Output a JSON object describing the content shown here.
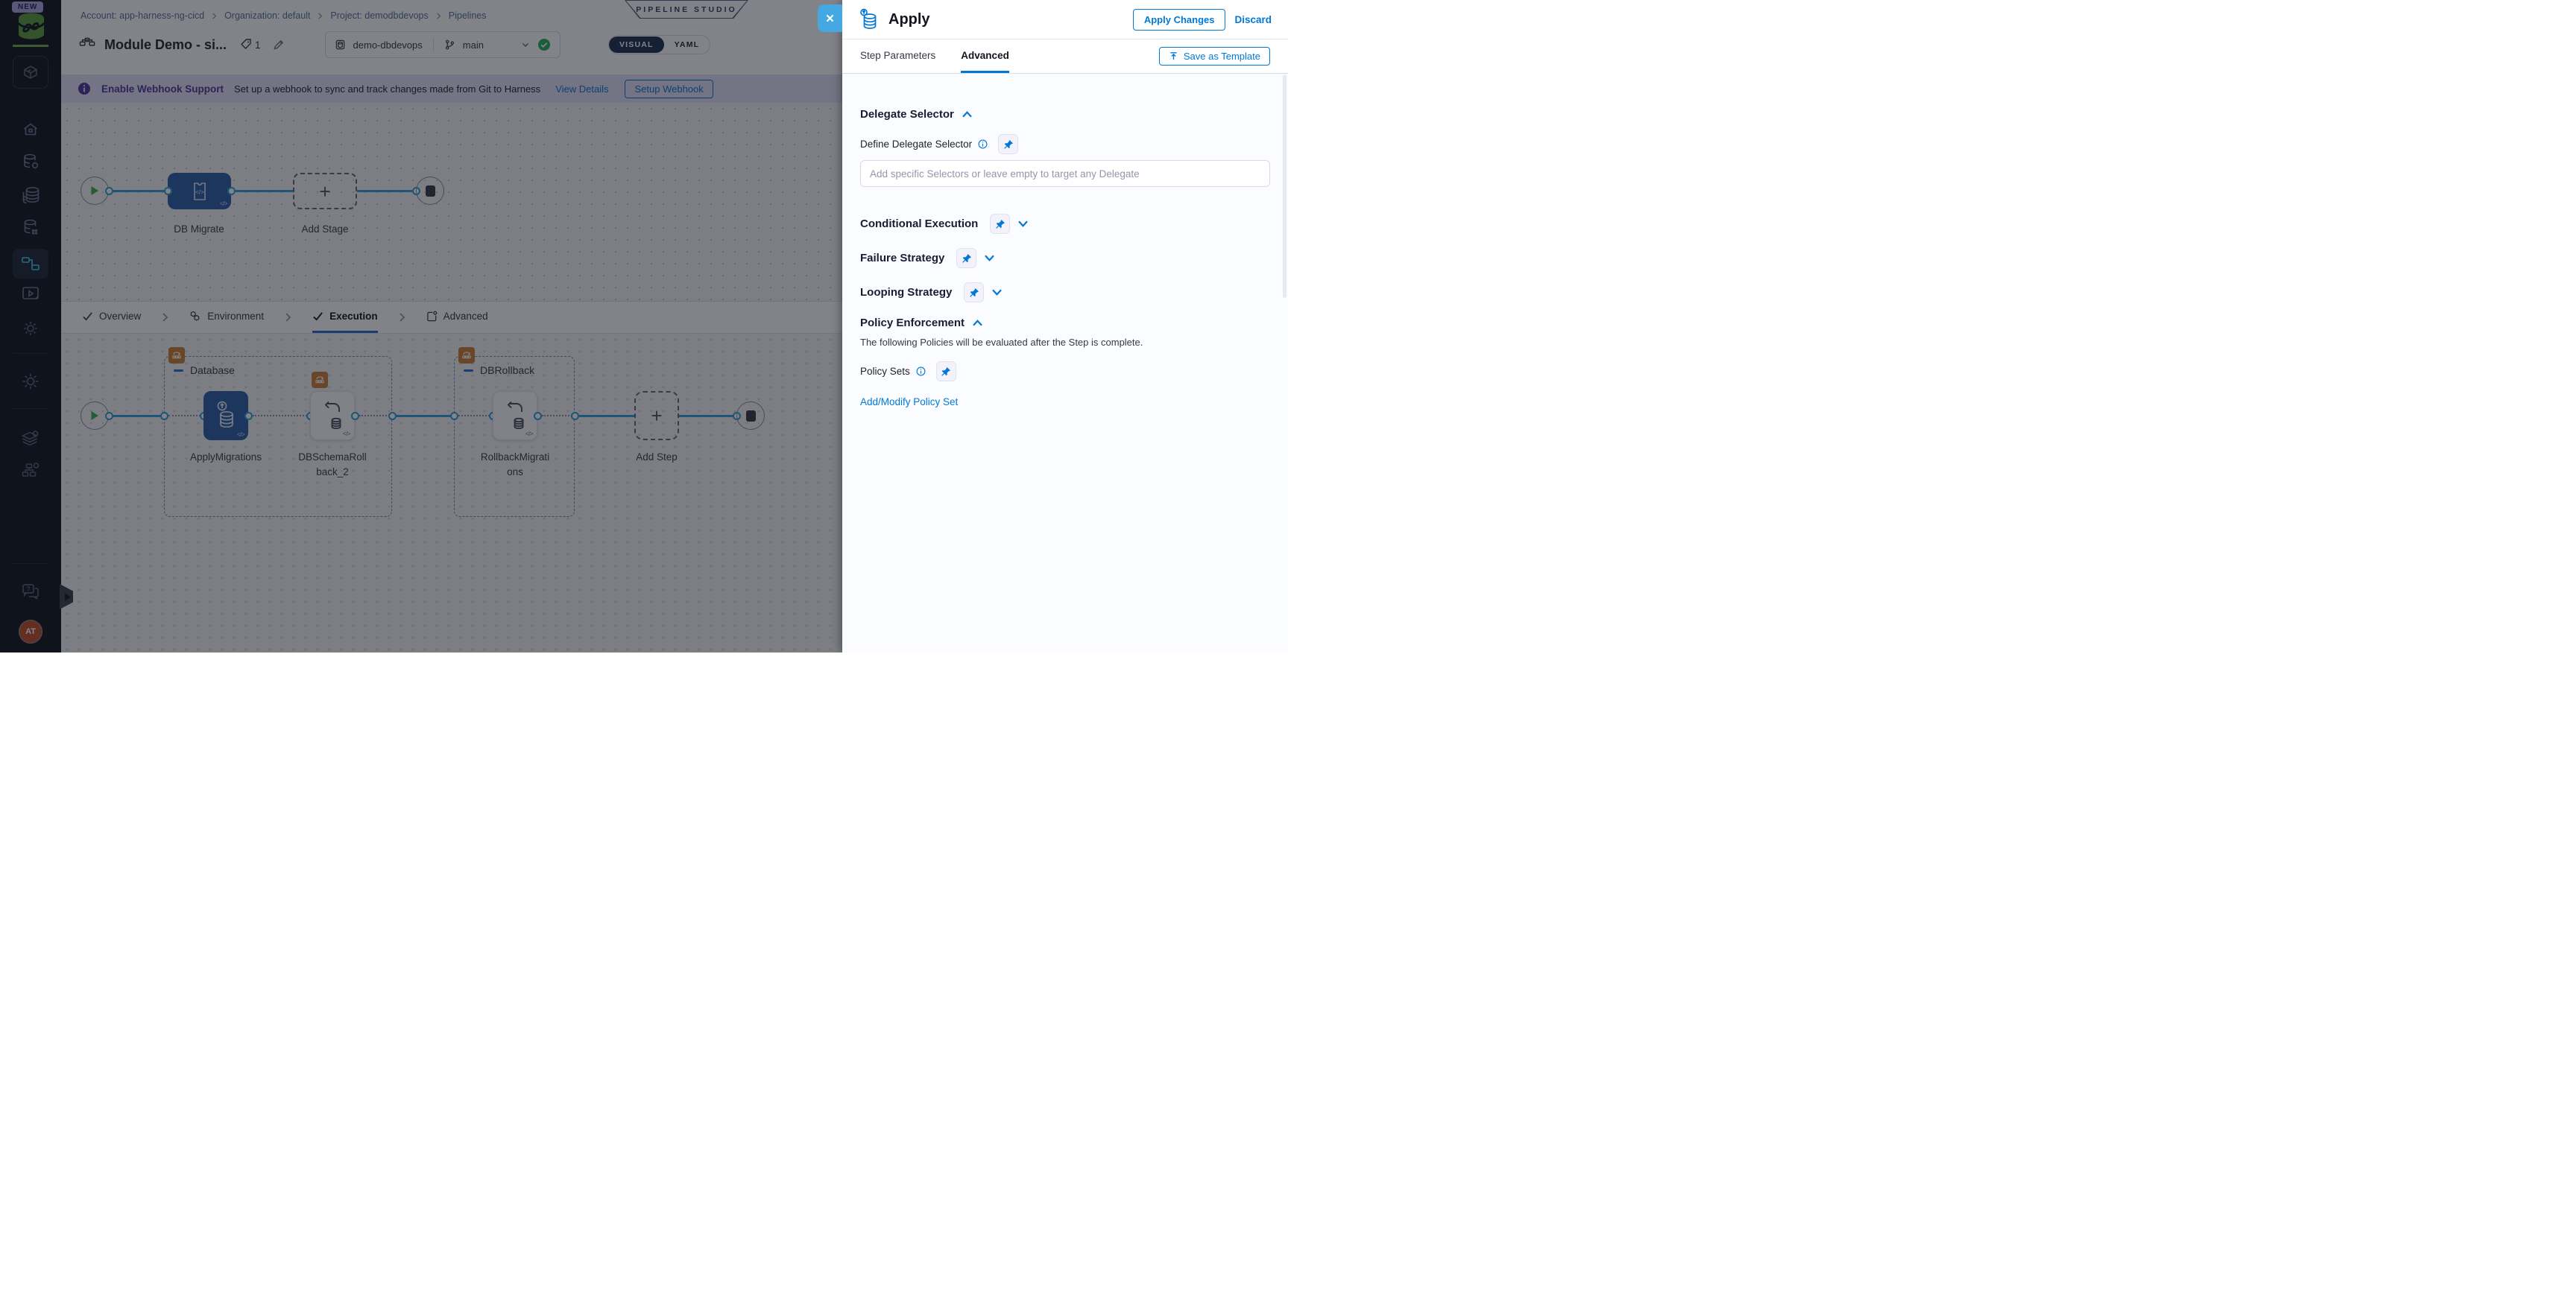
{
  "icons": {
    "close": "✕",
    "plus": "+",
    "code": "</>"
  },
  "sidebar": {
    "new_badge": "NEW",
    "avatar_initials": "AT"
  },
  "header": {
    "breadcrumbs": [
      {
        "label": "Account: app-harness-ng-cicd"
      },
      {
        "label": "Organization: default"
      },
      {
        "label": "Project: demodbdevops"
      },
      {
        "label": "Pipelines"
      }
    ],
    "studio_ribbon": "PIPELINE STUDIO",
    "title": "Module Demo - si...",
    "tag_count": "1",
    "repo": "demo-dbdevops",
    "branch": "main",
    "view_toggle": {
      "visual": "VISUAL",
      "yaml": "YAML"
    }
  },
  "banner": {
    "title": "Enable Webhook Support",
    "description": "Set up a webhook to sync and track changes made from Git to Harness",
    "link": "View Details",
    "button": "Setup Webhook"
  },
  "stage_canvas": {
    "stage_label": "DB Migrate",
    "add_stage": "Add Stage"
  },
  "stage_tabs": [
    {
      "label": "Overview"
    },
    {
      "label": "Environment"
    },
    {
      "label": "Execution"
    },
    {
      "label": "Advanced"
    }
  ],
  "execution_canvas": {
    "groups": [
      {
        "name": "Database"
      },
      {
        "name": "DBRollback"
      }
    ],
    "steps": [
      {
        "label": "ApplyMigrations"
      },
      {
        "label": "DBSchemaRollback_2"
      },
      {
        "label": "RollbackMigrations"
      }
    ],
    "add_step": "Add Step"
  },
  "drawer": {
    "title": "Apply",
    "apply_button": "Apply Changes",
    "discard_button": "Discard",
    "tabs": [
      {
        "label": "Step Parameters"
      },
      {
        "label": "Advanced"
      }
    ],
    "save_as_template": "Save as Template",
    "delegate": {
      "header": "Delegate Selector",
      "label": "Define Delegate Selector",
      "placeholder": "Add specific Selectors or leave empty to target any Delegate"
    },
    "sections": [
      {
        "label": "Conditional Execution"
      },
      {
        "label": "Failure Strategy"
      },
      {
        "label": "Looping Strategy"
      }
    ],
    "policy": {
      "header": "Policy Enforcement",
      "description": "The following Policies will be evaluated after the Step is complete.",
      "label": "Policy Sets",
      "link": "Add/Modify Policy Set"
    }
  },
  "colors": {
    "accent": "#0278d5",
    "node_blue": "#2a5ea8",
    "connector": "#2d9fd9",
    "success": "#27ae60",
    "sidebar_bg": "#10151f",
    "banner_bg": "#e3e0f6"
  }
}
